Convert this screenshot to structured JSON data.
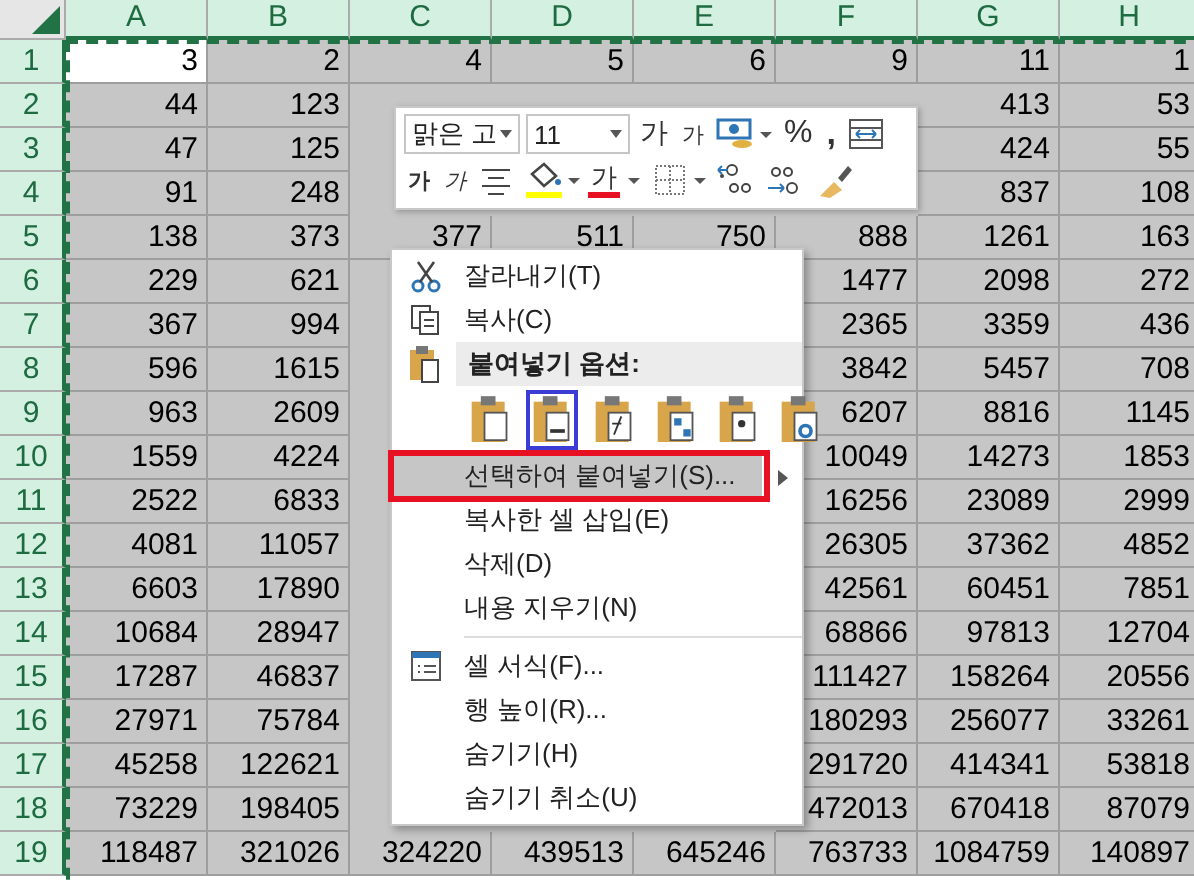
{
  "columns": [
    "A",
    "B",
    "C",
    "D",
    "E",
    "F",
    "G",
    "H"
  ],
  "rows": [
    {
      "header": "1",
      "cells": [
        {
          "text": "3",
          "active": true
        },
        "2",
        "4",
        "5",
        "6",
        "9",
        "11",
        "1"
      ]
    },
    {
      "header": "2",
      "cells": [
        "44",
        "123",
        null,
        null,
        null,
        null,
        "413",
        "53"
      ]
    },
    {
      "header": "3",
      "cells": [
        "47",
        "125",
        null,
        null,
        null,
        null,
        "424",
        "55"
      ]
    },
    {
      "header": "4",
      "cells": [
        "91",
        "248",
        null,
        null,
        null,
        null,
        "837",
        "108"
      ]
    },
    {
      "header": "5",
      "cells": [
        "138",
        "373",
        "377",
        "511",
        "750",
        "888",
        "1261",
        "163"
      ]
    },
    {
      "header": "6",
      "cells": [
        "229",
        "621",
        null,
        null,
        null,
        "1477",
        "2098",
        "272"
      ]
    },
    {
      "header": "7",
      "cells": [
        "367",
        "994",
        null,
        null,
        null,
        "2365",
        "3359",
        "436"
      ]
    },
    {
      "header": "8",
      "cells": [
        "596",
        "1615",
        null,
        null,
        null,
        "3842",
        "5457",
        "708"
      ]
    },
    {
      "header": "9",
      "cells": [
        "963",
        "2609",
        null,
        null,
        null,
        "6207",
        "8816",
        "1145"
      ]
    },
    {
      "header": "10",
      "cells": [
        "1559",
        "4224",
        null,
        null,
        null,
        "10049",
        "14273",
        "1853"
      ]
    },
    {
      "header": "11",
      "cells": [
        "2522",
        "6833",
        null,
        null,
        null,
        "16256",
        "23089",
        "2999"
      ]
    },
    {
      "header": "12",
      "cells": [
        "4081",
        "11057",
        null,
        null,
        null,
        "26305",
        "37362",
        "4852"
      ]
    },
    {
      "header": "13",
      "cells": [
        "6603",
        "17890",
        null,
        null,
        null,
        "42561",
        "60451",
        "7851"
      ]
    },
    {
      "header": "14",
      "cells": [
        "10684",
        "28947",
        null,
        null,
        null,
        "68866",
        "97813",
        "12704"
      ]
    },
    {
      "header": "15",
      "cells": [
        "17287",
        "46837",
        null,
        null,
        null,
        "111427",
        "158264",
        "20556"
      ]
    },
    {
      "header": "16",
      "cells": [
        "27971",
        "75784",
        null,
        null,
        null,
        "180293",
        "256077",
        "33261"
      ]
    },
    {
      "header": "17",
      "cells": [
        "45258",
        "122621",
        null,
        null,
        null,
        "291720",
        "414341",
        "53818"
      ]
    },
    {
      "header": "18",
      "cells": [
        "73229",
        "198405",
        null,
        null,
        null,
        "472013",
        "670418",
        "87079"
      ]
    },
    {
      "header": "19",
      "cells": [
        "118487",
        "321026",
        "324220",
        "439513",
        "645246",
        "763733",
        "1084759",
        "140897"
      ]
    }
  ],
  "mini_toolbar": {
    "font_name": "맑은 고",
    "font_size": "11",
    "grow_font": "가",
    "shrink_font": "가",
    "percent": "%",
    "comma": ",",
    "bold": "가",
    "italic": "가",
    "font_color": "가"
  },
  "context_menu": {
    "items": [
      {
        "kind": "item",
        "label": "잘라내기(T)"
      },
      {
        "kind": "item",
        "label": "복사(C)"
      },
      {
        "kind": "header",
        "label": "붙여넣기 옵션:"
      },
      {
        "kind": "paste_options",
        "options": [
          {
            "selected": false
          },
          {
            "selected": true
          },
          {
            "selected": false
          },
          {
            "selected": false
          },
          {
            "selected": false
          },
          {
            "selected": false
          }
        ]
      },
      {
        "kind": "item",
        "label": "선택하여 붙여넣기(S)...",
        "highlighted": true,
        "submenu": true,
        "annotated": true
      },
      {
        "kind": "item",
        "label": "복사한 셀 삽입(E)"
      },
      {
        "kind": "item",
        "label": "삭제(D)"
      },
      {
        "kind": "item",
        "label": "내용 지우기(N)"
      },
      {
        "kind": "separator"
      },
      {
        "kind": "item",
        "label": "셀 서식(F)..."
      },
      {
        "kind": "item",
        "label": "행 높이(R)..."
      },
      {
        "kind": "item",
        "label": "숨기기(H)"
      },
      {
        "kind": "item",
        "label": "숨기기 취소(U)"
      }
    ]
  }
}
